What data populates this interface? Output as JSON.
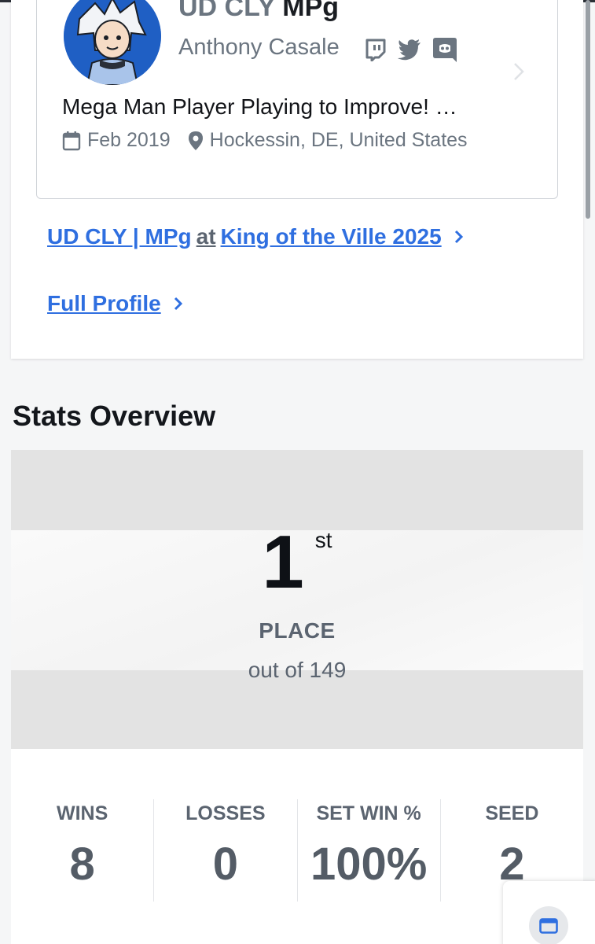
{
  "profile": {
    "gamertag_prefix": "UD CLY ",
    "gamertag": "MPg",
    "real_name": "Anthony Casale",
    "bio": "Mega Man Player Playing to Improve! …",
    "joined": "Feb 2019",
    "location": "Hockessin, DE, United States",
    "socials": [
      "twitch-icon",
      "twitter-icon",
      "discord-icon"
    ]
  },
  "links": {
    "player_event": "UD CLY | MPg",
    "at": "at",
    "event_name": "King of the Ville 2025",
    "full_profile": "Full Profile"
  },
  "stats": {
    "section_title": "Stats Overview",
    "placement": "1",
    "placement_suffix": "st",
    "place_label": "PLACE",
    "out_of": "out of 149",
    "items": [
      {
        "label": "WINS",
        "value": "8"
      },
      {
        "label": "LOSSES",
        "value": "0"
      },
      {
        "label": "SET WIN %",
        "value": "100%"
      },
      {
        "label": "SEED",
        "value": "2"
      }
    ]
  },
  "colors": {
    "link": "#2f6fe0",
    "muted": "#6b7580",
    "avatar_bg": "#1f5fc4"
  }
}
